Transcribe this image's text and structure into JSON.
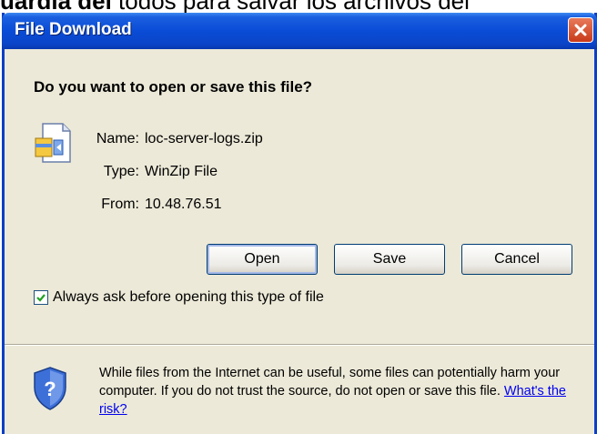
{
  "background": {
    "bold_part": "uardia del",
    "rest": " todos para salvar los archivos del"
  },
  "dialog": {
    "title": "File Download",
    "question": "Do you want to open or save this file?",
    "file": {
      "name_label": "Name:",
      "name_value": "loc-server-logs.zip",
      "type_label": "Type:",
      "type_value": "WinZip File",
      "from_label": "From:",
      "from_value": "10.48.76.51"
    },
    "buttons": {
      "open": "Open",
      "save": "Save",
      "cancel": "Cancel"
    },
    "checkbox": {
      "label": "Always ask before opening this type of file",
      "checked": true
    },
    "warning": {
      "text": "While files from the Internet can be useful, some files can potentially harm your computer. If you do not trust the source, do not open or save this file.",
      "link": "What's the risk?"
    }
  },
  "colors": {
    "title_bar": "#0a4cd6",
    "dialog_bg": "#ece9d8",
    "close_button": "#c83a1a",
    "link": "#0000ee"
  },
  "icons": [
    "close-icon",
    "winzip-file-icon",
    "checkmark-icon",
    "security-shield-icon"
  ]
}
